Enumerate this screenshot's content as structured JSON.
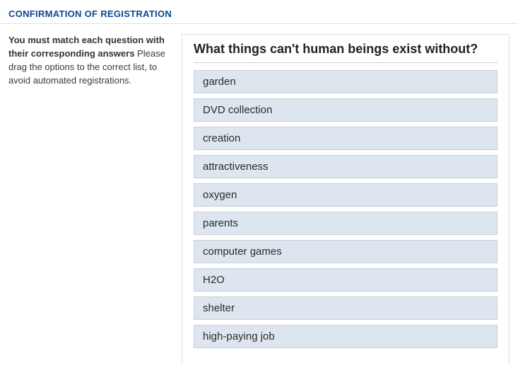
{
  "header": {
    "title": "CONFIRMATION OF REGISTRATION"
  },
  "left": {
    "bold_line": "You must match each question with their corresponding answers",
    "plain_line": " Please drag the options to the correct list, to avoid automated registrations."
  },
  "question": "What things can't human beings exist without?",
  "options": [
    "garden",
    "DVD collection",
    "creation",
    "attractiveness",
    "oxygen",
    "parents",
    "computer games",
    "H2O",
    "shelter",
    "high-paying job"
  ]
}
